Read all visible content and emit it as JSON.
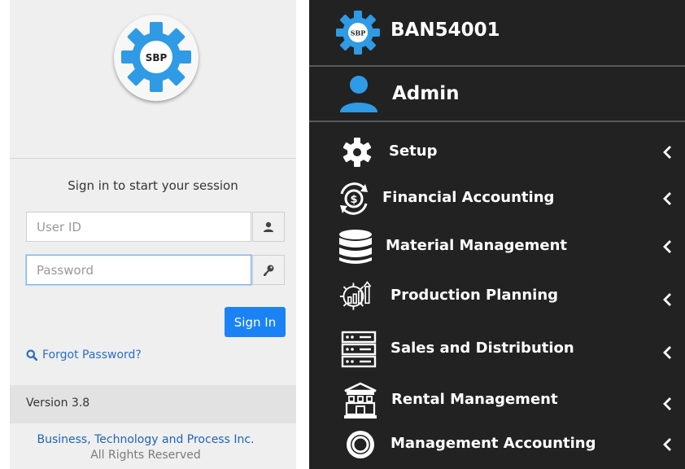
{
  "login": {
    "logo_text": "SBP",
    "prompt": "Sign in to start your session",
    "user_id_placeholder": "User ID",
    "password_placeholder": "Password",
    "sign_in_label": "Sign In",
    "forgot_label": "Forgot Password?",
    "version": "Version 3.8",
    "company": "Business, Technology and Process Inc.",
    "rights": "All Rights Reserved"
  },
  "sidebar": {
    "logo_text": "SBP",
    "title": "BAN54001",
    "user": "Admin",
    "items": [
      {
        "label": "Setup",
        "icon": "gear-icon"
      },
      {
        "label": "Financial Accounting",
        "icon": "dollar-cycle-icon"
      },
      {
        "label": "Material Management",
        "icon": "database-icon"
      },
      {
        "label": "Production Planning",
        "icon": "production-gear-chart-icon"
      },
      {
        "label": "Sales and Distribution",
        "icon": "server-rack-icon"
      },
      {
        "label": "Rental Management",
        "icon": "building-icon"
      },
      {
        "label": "Management Accounting",
        "icon": "ring-icon"
      }
    ]
  },
  "colors": {
    "accent_blue": "#1a82f5",
    "logo_blue": "#2f9ae5",
    "sidebar_bg": "#222222",
    "link_blue": "#2a6fc4"
  }
}
